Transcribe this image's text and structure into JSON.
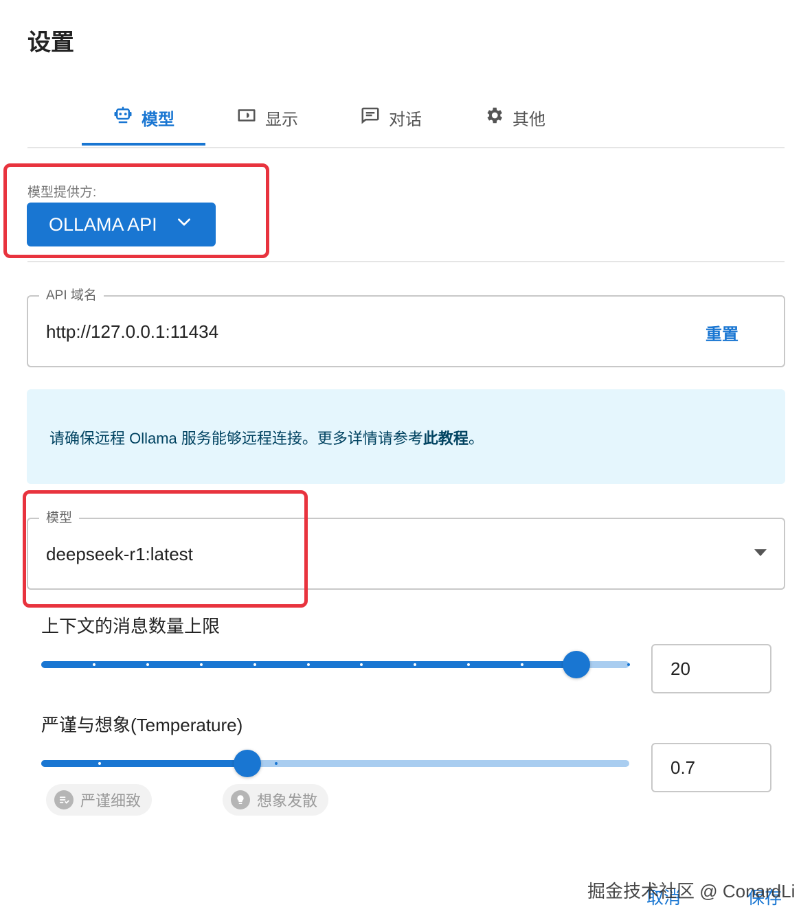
{
  "title": "设置",
  "tabs": [
    {
      "label": "模型",
      "icon": "robot-icon",
      "active": true
    },
    {
      "label": "显示",
      "icon": "display-icon",
      "active": false
    },
    {
      "label": "对话",
      "icon": "chat-icon",
      "active": false
    },
    {
      "label": "其他",
      "icon": "gear-icon",
      "active": false
    }
  ],
  "provider": {
    "label": "模型提供方:",
    "value": "OLLAMA API"
  },
  "api_host": {
    "legend": "API 域名",
    "value": "http://127.0.0.1:11434",
    "reset_label": "重置"
  },
  "info": {
    "text": "请确保远程 Ollama 服务能够远程连接。更多详情请参考",
    "link": "此教程",
    "end": "。"
  },
  "model": {
    "legend": "模型",
    "value": "deepseek-r1:latest"
  },
  "context_limit": {
    "label": "上下文的消息数量上限",
    "value": "20",
    "fraction": 0.91
  },
  "temperature": {
    "label": "严谨与想象(Temperature)",
    "value": "0.7",
    "fraction": 0.35,
    "chip_left": "严谨细致",
    "chip_right": "想象发散"
  },
  "footer": {
    "cancel": "取消",
    "save": "保存"
  },
  "watermark": "掘金技术社区 @ ConardLi",
  "colors": {
    "accent": "#1976d2",
    "highlight": "#e8333e",
    "info_bg": "#e5f6fd"
  }
}
